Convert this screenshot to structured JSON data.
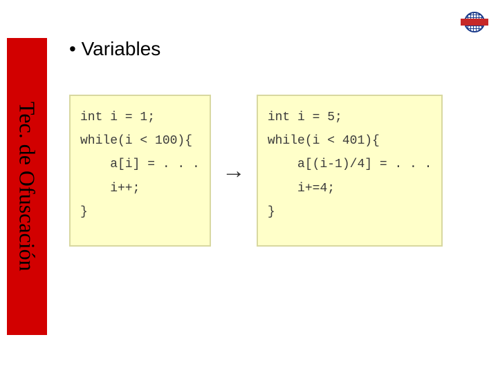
{
  "sidebar": {
    "title": "Tec. de Ofuscación"
  },
  "content": {
    "bullet": "•  Variables"
  },
  "code": {
    "left": "int i = 1;\nwhile(i < 100){\n    a[i] = . . .\n    i++;\n}",
    "right": "int i = 5;\nwhile(i < 401){\n    a[(i-1)/4] = . . .\n    i+=4;\n}"
  },
  "arrow": "→"
}
